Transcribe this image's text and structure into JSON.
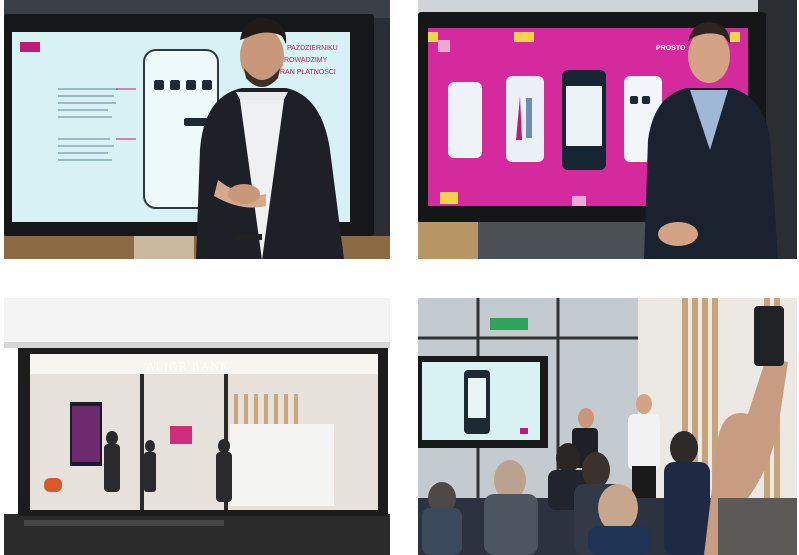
{
  "collage": {
    "photo_1": {
      "screen_text": [
        "PAŹDZIERNIKU",
        "ROWADZIMY",
        "RAN PŁATNOŚCI"
      ]
    },
    "photo_2": {
      "screen_text": "PROSTO",
      "accent": "#d42a9e"
    },
    "photo_3": {
      "sign_text": "ALIOR BANK"
    },
    "photo_4": {
      "exit_sign": "",
      "screen_accent": "#c01b6d"
    }
  }
}
